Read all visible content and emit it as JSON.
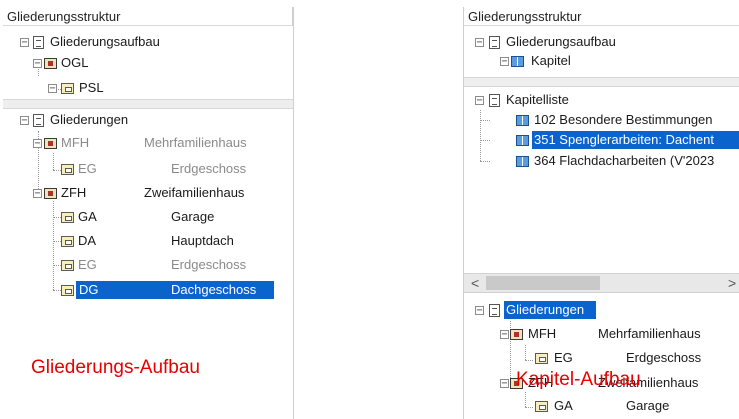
{
  "left": {
    "header": "Gliederungsstruktur",
    "tree1": {
      "root": "Gliederungsaufbau",
      "n1": "OGL",
      "n2": "PSL"
    },
    "tree2": {
      "root": "Gliederungen",
      "rows": [
        {
          "code": "MFH",
          "desc": "Mehrfamilienhaus"
        },
        {
          "code": "EG",
          "desc": "Erdgeschoss"
        },
        {
          "code": "ZFH",
          "desc": "Zweifamilienhaus"
        },
        {
          "code": "GA",
          "desc": "Garage"
        },
        {
          "code": "DA",
          "desc": "Hauptdach"
        },
        {
          "code": "EG",
          "desc": "Erdgeschoss"
        },
        {
          "code": "DG",
          "desc": "Dachgeschoss"
        }
      ]
    },
    "caption": "Gliederungs-Aufbau"
  },
  "right": {
    "header": "Gliederungsstruktur",
    "tree1": {
      "root": "Gliederungsaufbau",
      "n1": "Kapitel"
    },
    "list": {
      "root": "Kapitelliste",
      "items": [
        "102 Besondere Bestimmungen",
        "351 Spenglerarbeiten: Dachent",
        "364 Flachdacharbeiten (V'2023"
      ]
    },
    "scroll": {
      "left": "<",
      "right": ">"
    },
    "tree2": {
      "root": "Gliederungen",
      "rows": [
        {
          "code": "MFH",
          "desc": "Mehrfamilienhaus"
        },
        {
          "code": "EG",
          "desc": "Erdgeschoss"
        },
        {
          "code": "ZFH",
          "desc": "Zweifamilienhaus"
        },
        {
          "code": "GA",
          "desc": "Garage"
        }
      ]
    },
    "caption": "Kapitel-Aufbau"
  },
  "colors": {
    "selection": "#0b63ce",
    "caption": "#e60000",
    "muted": "#8a8a8a"
  }
}
